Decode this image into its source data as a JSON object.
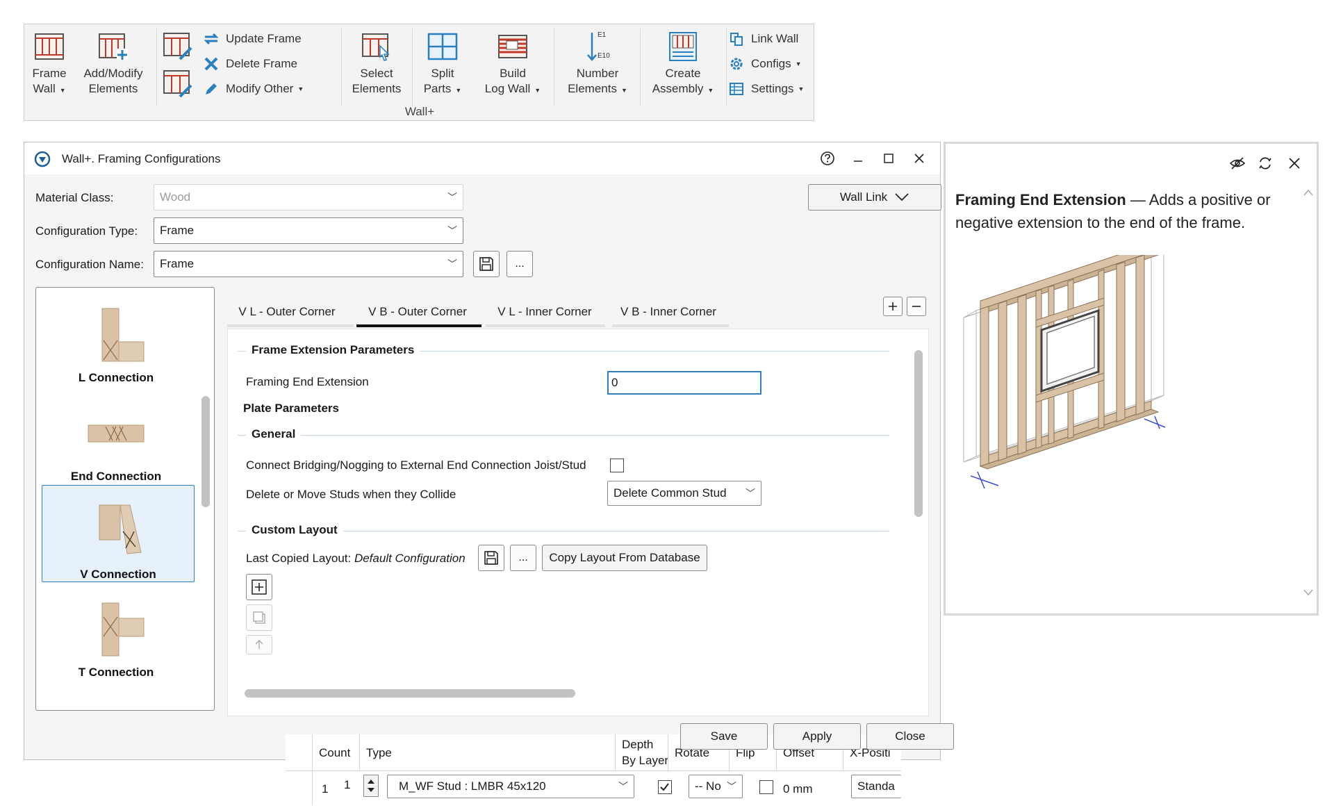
{
  "ribbon": {
    "group_label": "Wall+",
    "buttons": {
      "frame_wall": [
        "Frame",
        "Wall"
      ],
      "add_modify": [
        "Add/Modify",
        "Elements"
      ],
      "select": [
        "Select",
        "Elements"
      ],
      "split": [
        "Split",
        "Parts"
      ],
      "build": [
        "Build",
        "Log Wall"
      ],
      "number": [
        "Number",
        "Elements"
      ],
      "assembly": [
        "Create",
        "Assembly"
      ]
    },
    "small": {
      "update_frame": "Update Frame",
      "delete_frame": "Delete Frame",
      "modify_other": "Modify Other",
      "link_wall": "Link Wall",
      "configs": "Configs",
      "settings": "Settings"
    },
    "number_icon_top": "E1",
    "number_icon_bottom": "E10"
  },
  "dialog": {
    "title": "Wall+. Framing Configurations",
    "material_class_label": "Material Class:",
    "material_class_value": "Wood",
    "config_type_label": "Configuration Type:",
    "config_type_value": "Frame",
    "config_name_label": "Configuration Name:",
    "config_name_value": "Frame",
    "more_label": "...",
    "wall_link_label": "Wall Link",
    "connections": [
      "L Connection",
      "End Connection",
      "V Connection",
      "T Connection"
    ],
    "selected_connection": "V Connection",
    "tabs": [
      "V L - Outer Corner",
      "V B - Outer Corner",
      "V L - Inner Corner",
      "V B - Inner Corner"
    ],
    "active_tab": "V B - Outer Corner",
    "sections": {
      "frame_extension": "Frame Extension Parameters",
      "framing_end_extension_label": "Framing End Extension",
      "framing_end_extension_value": "0",
      "plate": "Plate Parameters",
      "general": "General",
      "connect_bridging_label": "Connect Bridging/Nogging to External End Connection Joist/Stud",
      "connect_bridging_checked": false,
      "collide_label": "Delete or Move Studs when they Collide",
      "collide_value": "Delete Common Stud",
      "custom_layout": "Custom Layout",
      "last_copied_label": "Last Copied Layout:",
      "last_copied_value": "Default Configuration",
      "copy_layout_button": "Copy Layout From Database"
    },
    "grid": {
      "columns": [
        "Count",
        "Type",
        "Depth",
        "By Layer",
        "Rotate",
        "Flip",
        "Offset",
        "X-Positi"
      ],
      "rows": [
        {
          "index": "1",
          "count": "1",
          "type": "M_WF Stud : LMBR 45x120",
          "depth_by_layer": true,
          "rotate": "-- No",
          "flip": false,
          "offset": "0 mm",
          "x_position": "Standa"
        }
      ]
    },
    "footer": {
      "save": "Save",
      "apply": "Apply",
      "close": "Close"
    }
  },
  "help": {
    "term": "Framing End Extension",
    "description": " — Adds a positive or negative extension to the end of the frame."
  },
  "colors": {
    "accent": "#2d7fc0",
    "wood": "#d9c2a5",
    "selection_bg": "#e6f1fb"
  }
}
